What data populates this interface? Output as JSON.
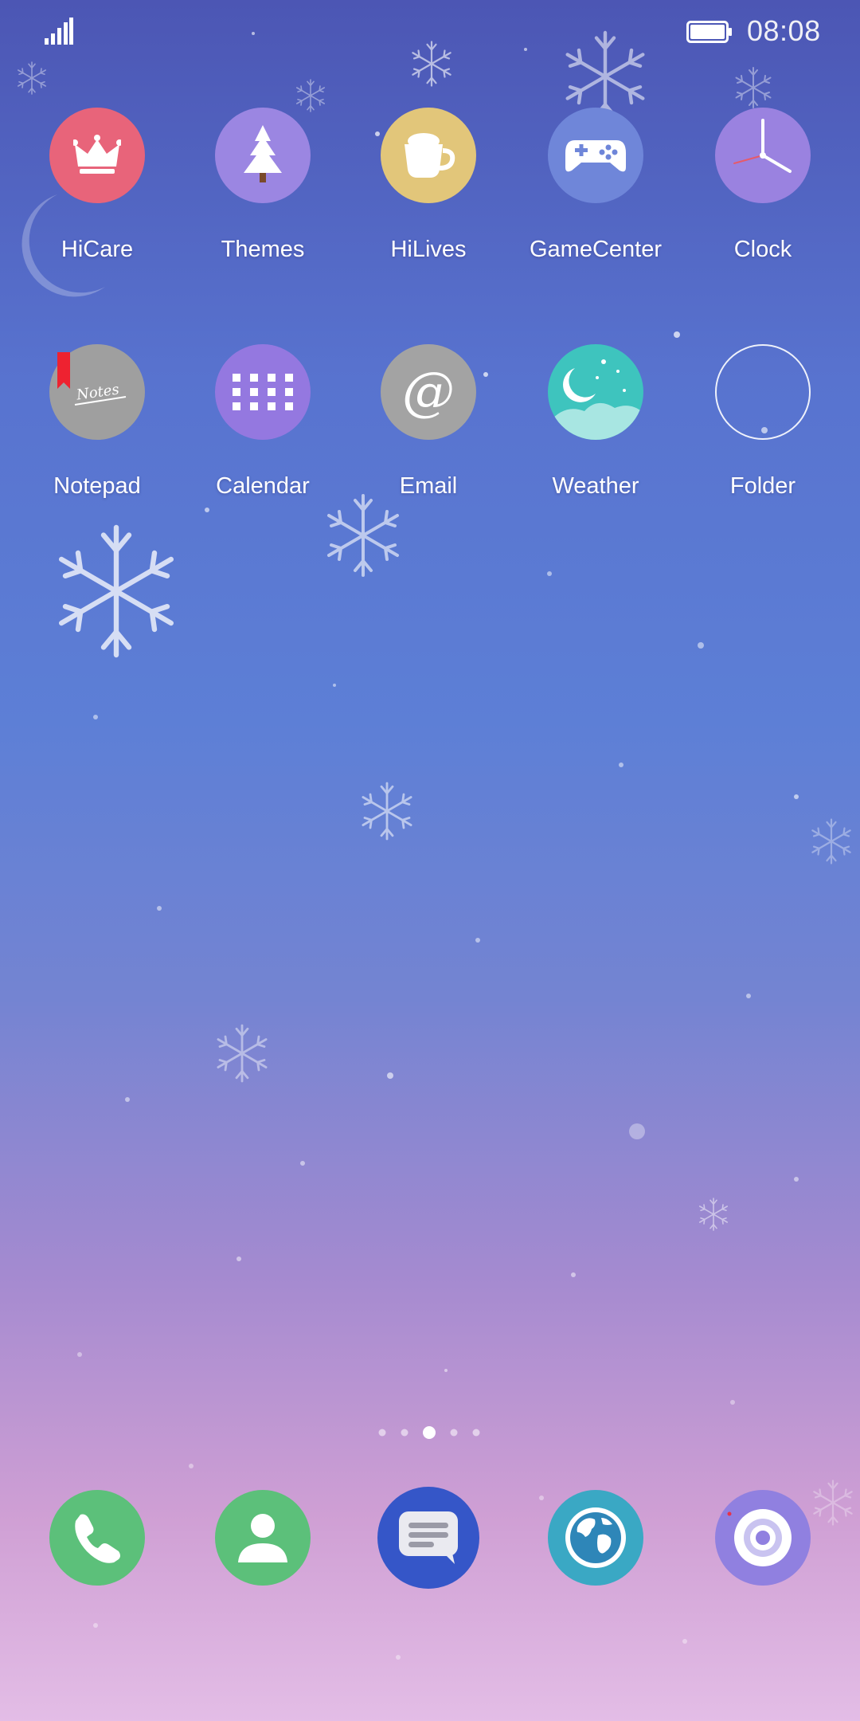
{
  "status_bar": {
    "time": "08:08",
    "signal_icon": "signal-bars-icon",
    "battery_icon": "battery-icon"
  },
  "apps": [
    {
      "label": "HiCare",
      "icon": "crown-icon",
      "color": "#e8647a"
    },
    {
      "label": "Themes",
      "icon": "tree-icon",
      "color": "#9b86e2"
    },
    {
      "label": "HiLives",
      "icon": "cup-icon",
      "color": "#e2c67a"
    },
    {
      "label": "GameCenter",
      "icon": "gamepad-icon",
      "color": "#6f86d9"
    },
    {
      "label": "Clock",
      "icon": "clock-icon",
      "color": "#9a82e0"
    },
    {
      "label": "Notepad",
      "icon": "notes-icon",
      "icon_text": "Notes",
      "color": "#9f9f9f"
    },
    {
      "label": "Calendar",
      "icon": "calendar-icon",
      "color": "#9478e0"
    },
    {
      "label": "Email",
      "icon": "at-icon",
      "icon_text": "@",
      "color": "#a3a3a3"
    },
    {
      "label": "Weather",
      "icon": "moon-cloud-icon",
      "color": "#3ec4be"
    },
    {
      "label": "Folder",
      "icon": "folder-outline-icon",
      "color": "transparent"
    }
  ],
  "page_indicator": {
    "count": 5,
    "active": 3
  },
  "dock": [
    {
      "name": "phone",
      "icon": "phone-icon",
      "color": "#5cc07a"
    },
    {
      "name": "contacts",
      "icon": "contacts-icon",
      "color": "#5cc07a"
    },
    {
      "name": "messages",
      "icon": "message-icon",
      "color": "#3556c8"
    },
    {
      "name": "browser",
      "icon": "globe-icon",
      "color": "#3aa8c4"
    },
    {
      "name": "camera",
      "icon": "camera-icon",
      "color": "#9080e0"
    }
  ]
}
